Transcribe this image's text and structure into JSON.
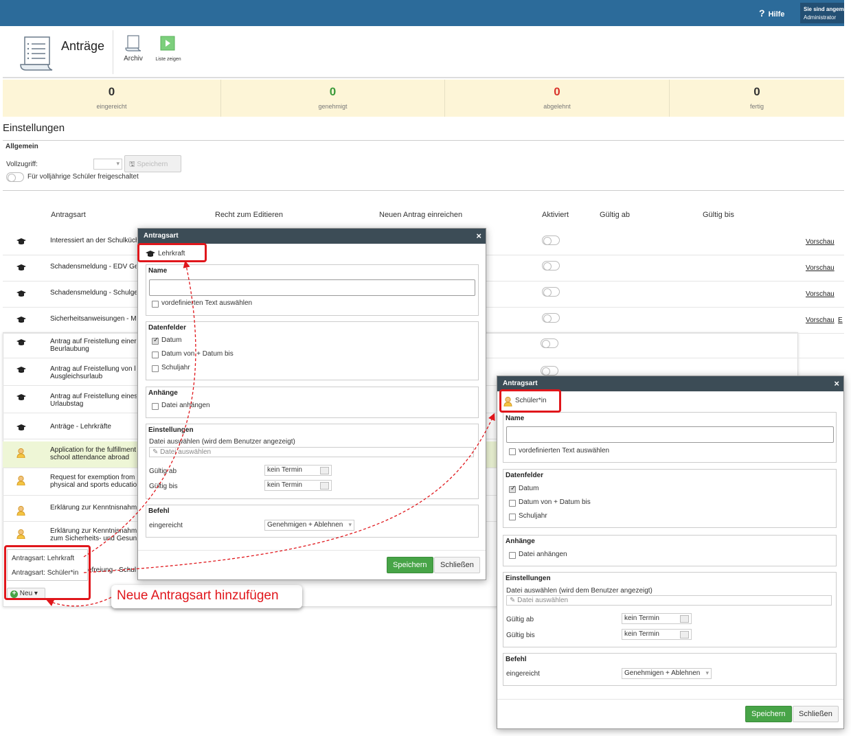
{
  "header": {
    "help_label": "Hilfe",
    "user_line1": "Sie sind angemeldet als",
    "user_line2": "Administrator"
  },
  "module": {
    "title": "Anträge",
    "archive_label": "Archiv",
    "show_list_label": "Liste zeigen"
  },
  "stats": [
    {
      "value": "0",
      "label": "eingereicht",
      "color": "#333333"
    },
    {
      "value": "0",
      "label": "genehmigt",
      "color": "#3a9a3a"
    },
    {
      "value": "0",
      "label": "abgelehnt",
      "color": "#d9342b"
    },
    {
      "value": "0",
      "label": "fertig",
      "color": "#333333"
    }
  ],
  "settings": {
    "title": "Einstellungen",
    "general_title": "Allgemein",
    "vollzugriff_label": "Vollzugriff:",
    "save_label": "Speichern",
    "adult_toggle_label": "Für volljährige Schüler freigeschaltet"
  },
  "table": {
    "columns": [
      "Antragsart",
      "Recht zum Editieren",
      "Neuen Antrag einreichen",
      "Aktiviert",
      "Gültig ab",
      "Gültig bis"
    ],
    "rows": [
      {
        "icon": "graduation-cap-icon",
        "text": "Interessiert an der Schulküche",
        "preview": "Vorschau"
      },
      {
        "icon": "graduation-cap-icon",
        "text": "Schadensmeldung - EDV Gerät",
        "preview": "Vorschau"
      },
      {
        "icon": "graduation-cap-icon",
        "text": "Schadensmeldung - Schulgebäude",
        "preview": "Vorschau"
      },
      {
        "icon": "graduation-cap-icon",
        "text": "Sicherheitsanweisungen - Merkblatt",
        "preview": "Vorschau",
        "extra": "E"
      },
      {
        "icon": "graduation-cap-icon",
        "text": "Antrag auf Freistellung einer\nBeurlaubung"
      },
      {
        "icon": "graduation-cap-icon",
        "text": "Antrag auf Freistellung von l\nAusgleichsurlaub"
      },
      {
        "icon": "graduation-cap-icon",
        "text": "Antrag auf Freistellung eines\nUrlaubstag"
      },
      {
        "icon": "graduation-cap-icon",
        "text": "Anträge - Lehrkräfte"
      },
      {
        "icon": "student-icon",
        "text": "Application for the fulfillment\nschool attendance abroad"
      },
      {
        "icon": "student-icon",
        "text": "Request for exemption from\nphysical and sports educatio"
      },
      {
        "icon": "student-icon",
        "text": "Erklärung zur Kenntnisnahm"
      },
      {
        "icon": "student-icon",
        "text": "Erklärung zur Kenntnisnahm\nzum Sicherheits- und Gesun"
      }
    ]
  },
  "new_menu": {
    "items": [
      "Antragsart: Lehrkraft",
      "Antragsart: Schüler*in"
    ],
    "button_label": "Neu ▾",
    "partial_row": "efreiung - Schul"
  },
  "annotation": "Neue Antragsart hinzufügen",
  "dialog_teacher": {
    "title": "Antragsart",
    "type": "Lehrkraft",
    "name_label": "Name",
    "predefined_label": "vordefinierten Text auswählen",
    "datafields_label": "Datenfelder",
    "field_date": "Datum",
    "field_range": "Datum von + Datum bis",
    "field_year": "Schuljahr",
    "attachments_label": "Anhänge",
    "attach_label": "Datei anhängen",
    "settings_label": "Einstellungen",
    "file_select_label": "Datei auswählen (wird dem Benutzer angezeigt)",
    "file_placeholder": "Datei auswählen",
    "valid_from_label": "Gültig ab",
    "valid_to_label": "Gültig bis",
    "no_date": "kein Termin",
    "command_label": "Befehl",
    "submitted_label": "eingereicht",
    "command_value": "Genehmigen + Ablehnen",
    "save_label": "Speichern",
    "close_label": "Schließen"
  },
  "dialog_student": {
    "title": "Antragsart",
    "type": "Schüler*in",
    "name_label": "Name",
    "predefined_label": "vordefinierten Text auswählen",
    "datafields_label": "Datenfelder",
    "field_date": "Datum",
    "field_range": "Datum von + Datum bis",
    "field_year": "Schuljahr",
    "attachments_label": "Anhänge",
    "attach_label": "Datei anhängen",
    "settings_label": "Einstellungen",
    "file_select_label": "Datei auswählen (wird dem Benutzer angezeigt)",
    "file_placeholder": "Datei auswählen",
    "valid_from_label": "Gültig ab",
    "valid_to_label": "Gültig bis",
    "no_date": "kein Termin",
    "command_label": "Befehl",
    "submitted_label": "eingereicht",
    "command_value": "Genehmigen + Ablehnen",
    "save_label": "Speichern",
    "close_label": "Schließen"
  },
  "colors": {
    "topbar": "#2c6b9a",
    "highlight_red": "#e0161b",
    "save_green": "#47a447",
    "stats_bg": "#fdf5d7",
    "row_highlight": "#eef6d6"
  }
}
